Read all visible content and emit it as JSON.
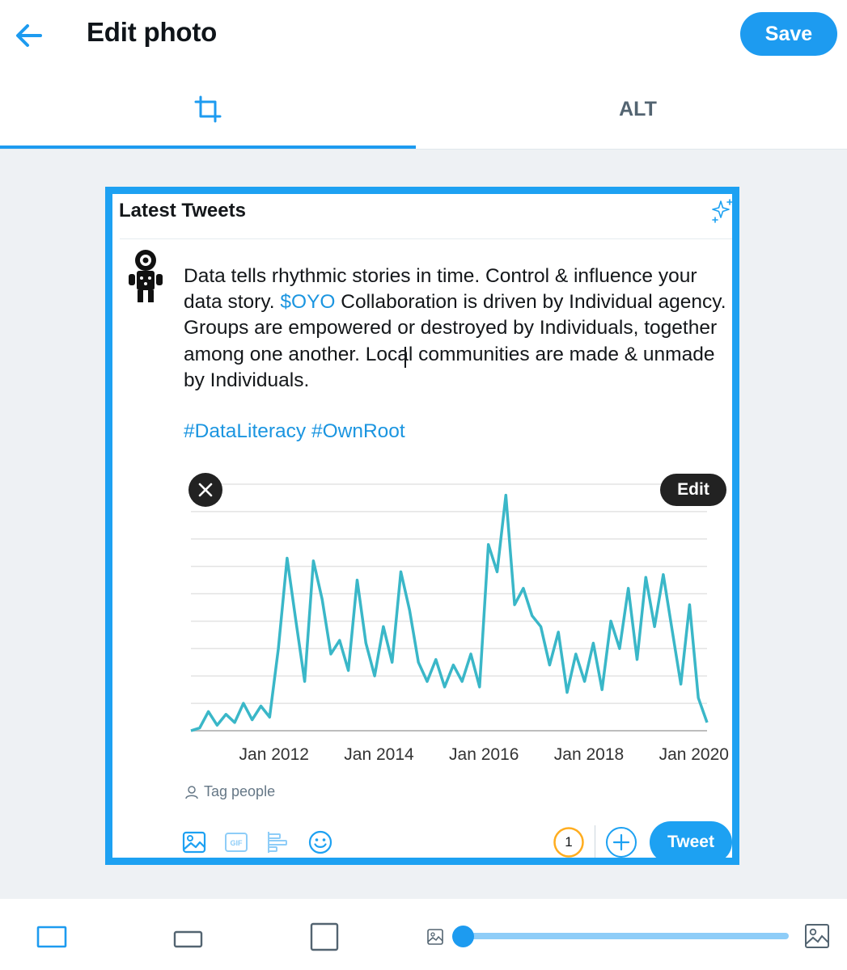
{
  "header": {
    "title": "Edit photo",
    "save_label": "Save",
    "back_icon": "arrow-left-icon"
  },
  "tabs": [
    {
      "id": "crop",
      "icon": "crop-icon",
      "active": true
    },
    {
      "id": "alt",
      "label": "ALT",
      "active": false
    }
  ],
  "colors": {
    "accent": "#1d9bf0",
    "canvas_bg": "#eef1f4",
    "frame_border": "#1da1f2",
    "chart_line": "#3ab7c8",
    "link": "#1b95e0"
  },
  "photo": {
    "heading": "Latest Tweets",
    "tweet": {
      "text_before_link": "Data tells rhythmic stories in time. Control & influence your data story. ",
      "cashtag": "$OYO",
      "text_after_link": " Collaboration is driven by Individual agency. Groups are empowered or destroyed by Individuals, together among one another. Local communities are made & unmade by Individuals.",
      "hashtags": "#DataLiteracy #OwnRoot"
    },
    "media_edit_label": "Edit",
    "tag_people_label": "Tag people",
    "char_counter": "1",
    "tweet_button_label": "Tweet",
    "toolbar_icons": [
      "image-icon",
      "gif-icon",
      "poll-icon",
      "emoji-icon"
    ]
  },
  "chart_data": {
    "type": "line",
    "x_ticks": [
      "Jan 2012",
      "Jan 2014",
      "Jan 2016",
      "Jan 2018",
      "Jan 2020"
    ],
    "x": [
      "Jun 2010",
      "Aug 2010",
      "Oct 2010",
      "Dec 2010",
      "Feb 2011",
      "Apr 2011",
      "Jun 2011",
      "Aug 2011",
      "Oct 2011",
      "Dec 2011",
      "Feb 2012",
      "Apr 2012",
      "Jun 2012",
      "Aug 2012",
      "Oct 2012",
      "Dec 2012",
      "Feb 2013",
      "Apr 2013",
      "Jun 2013",
      "Aug 2013",
      "Oct 2013",
      "Dec 2013",
      "Feb 2014",
      "Apr 2014",
      "Jun 2014",
      "Aug 2014",
      "Oct 2014",
      "Dec 2014",
      "Feb 2015",
      "Apr 2015",
      "Jun 2015",
      "Aug 2015",
      "Oct 2015",
      "Dec 2015",
      "Feb 2016",
      "Apr 2016",
      "Jun 2016",
      "Aug 2016",
      "Oct 2016",
      "Dec 2016",
      "Feb 2017",
      "Apr 2017",
      "Jun 2017",
      "Aug 2017",
      "Oct 2017",
      "Dec 2017",
      "Feb 2018",
      "Apr 2018",
      "Jun 2018",
      "Aug 2018",
      "Oct 2018",
      "Dec 2018",
      "Feb 2019",
      "Apr 2019",
      "Jun 2019",
      "Aug 2019",
      "Oct 2019",
      "Dec 2019",
      "Feb 2020",
      "Apr 2020"
    ],
    "values": [
      0,
      1,
      7,
      2,
      6,
      3,
      10,
      4,
      9,
      5,
      30,
      63,
      40,
      18,
      62,
      48,
      28,
      33,
      22,
      55,
      32,
      20,
      38,
      25,
      58,
      44,
      25,
      18,
      26,
      16,
      24,
      18,
      28,
      16,
      68,
      58,
      86,
      46,
      52,
      42,
      38,
      24,
      36,
      14,
      28,
      18,
      32,
      15,
      40,
      30,
      52,
      26,
      56,
      38,
      57,
      37,
      17,
      46,
      12,
      3
    ],
    "y_range": [
      0,
      90
    ],
    "grid": true,
    "gridlines": 9,
    "xlabel": "",
    "ylabel": "",
    "title": ""
  },
  "bottom_bar": {
    "aspect_icons": [
      "aspect-original-icon",
      "aspect-wide-icon",
      "aspect-square-icon"
    ],
    "zoom_min_icon": "image-small-icon",
    "zoom_max_icon": "image-large-icon",
    "zoom_level": 0
  }
}
